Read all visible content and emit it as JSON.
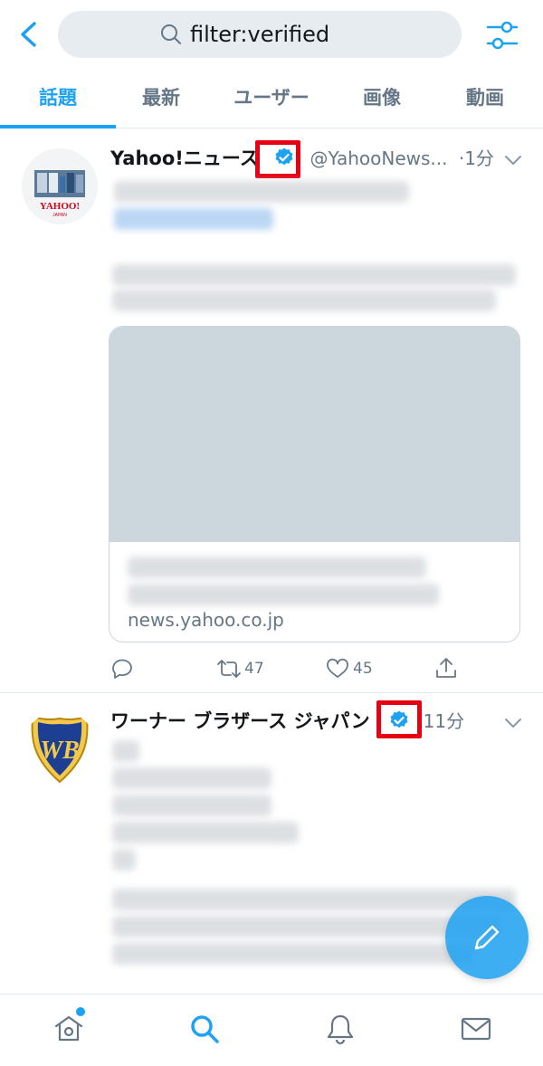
{
  "search": {
    "query": "filter:verified"
  },
  "tabs": [
    {
      "label": "話題",
      "active": true
    },
    {
      "label": "最新",
      "active": false
    },
    {
      "label": "ユーザー",
      "active": false
    },
    {
      "label": "画像",
      "active": false
    },
    {
      "label": "動画",
      "active": false
    }
  ],
  "tweets": [
    {
      "name": "Yahoo!ニュース",
      "handle": "@YahooNews...",
      "time": "·1分",
      "card_domain": "news.yahoo.co.jp",
      "retweets": "47",
      "likes": "45",
      "avatar_icon": "yahoo-japan-logo"
    },
    {
      "name": "ワーナー ブラザース ジャパン",
      "time": "·11分",
      "avatar_icon": "warner-bros-logo"
    }
  ],
  "colors": {
    "accent": "#1da1f2",
    "highlight": "#e60012",
    "muted": "#657786",
    "border": "#e1e8ed",
    "search_bg": "#e6ecf0"
  },
  "icons": {
    "back": "chevron-left-icon",
    "search": "search-icon",
    "filter": "sliders-icon",
    "home": "home-icon",
    "explore": "search-icon",
    "notifications": "bell-icon",
    "messages": "mail-icon",
    "compose": "compose-icon"
  }
}
